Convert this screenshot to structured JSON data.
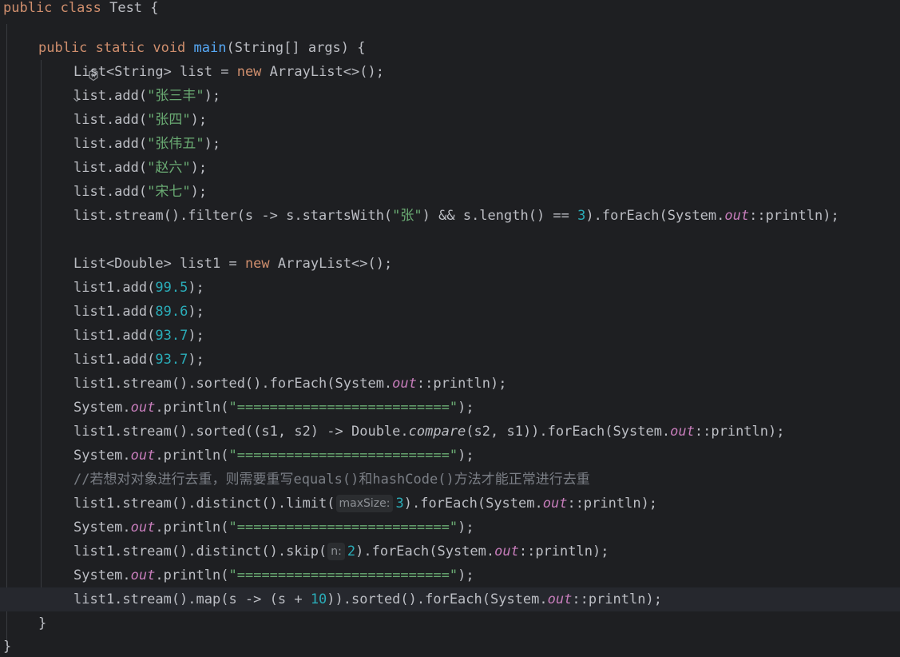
{
  "code": {
    "l1": [
      "public",
      " ",
      "class",
      " Test {"
    ],
    "l3": [
      "public",
      " ",
      "static",
      " ",
      "void",
      " ",
      "main",
      "(String[] args) {"
    ],
    "l4": [
      "List<String> list = ",
      "new",
      " ArrayList<>();"
    ],
    "l5": [
      "list.add(",
      "\"张三丰\"",
      ");"
    ],
    "l6": [
      "list.add(",
      "\"张四\"",
      ");"
    ],
    "l7": [
      "list.add(",
      "\"张伟五\"",
      ");"
    ],
    "l8": [
      "list.add(",
      "\"赵六\"",
      ");"
    ],
    "l9": [
      "list.add(",
      "\"宋七\"",
      ");"
    ],
    "l10": [
      "list.stream().filter(s -> s.startsWith(",
      "\"张\"",
      ") && s.length() == ",
      "3",
      ").forEach(System.",
      "out",
      "::println);"
    ],
    "l12": [
      "List<Double> list1 = ",
      "new",
      " ArrayList<>();"
    ],
    "l13": [
      "list1.add(",
      "99.5",
      ");"
    ],
    "l14": [
      "list1.add(",
      "89.6",
      ");"
    ],
    "l15": [
      "list1.add(",
      "93.7",
      ");"
    ],
    "l16": [
      "list1.add(",
      "93.7",
      ");"
    ],
    "l17": [
      "list1.stream().sorted().forEach(System.",
      "out",
      "::println);"
    ],
    "l18": [
      "System.",
      "out",
      ".println(",
      "\"==========================\"",
      ");"
    ],
    "l19": [
      "list1.stream().sorted((s1, s2) -> Double.",
      "compare",
      "(s2, s1)).forEach(System.",
      "out",
      "::println);"
    ],
    "l20": [
      "System.",
      "out",
      ".println(",
      "\"==========================\"",
      ");"
    ],
    "l21": [
      "//若想对对象进行去重，则需要重写equals()和hashCode()方法才能正常进行去重"
    ],
    "l22": [
      "list1.stream().distinct().limit(",
      "maxSize:",
      "3",
      ").forEach(System.",
      "out",
      "::println);"
    ],
    "l23": [
      "System.",
      "out",
      ".println(",
      "\"==========================\"",
      ");"
    ],
    "l24": [
      "list1.stream().distinct().skip(",
      "n:",
      "2",
      ").forEach(System.",
      "out",
      "::println);"
    ],
    "l25": [
      "System.",
      "out",
      ".println(",
      "\"==========================\"",
      ");"
    ],
    "l26": [
      "list1.stream().map(s -> (s + ",
      "10",
      ")).sorted().forEach(System.",
      "out",
      "::println);"
    ],
    "l27": [
      "}"
    ],
    "l28": [
      "}"
    ]
  },
  "icons": {
    "gutter_generate": "generate-code-icon",
    "gutter_dropdown": "chevron-down-icon"
  },
  "colors": {
    "background": "#1e1f22",
    "current_line": "#26282e",
    "keyword": "#cf8e6d",
    "method_decl": "#56a8f5",
    "string": "#6aab73",
    "number": "#2aacb8",
    "static_field": "#c77dbb",
    "comment": "#7a7e85",
    "default_text": "#bcbec4"
  }
}
